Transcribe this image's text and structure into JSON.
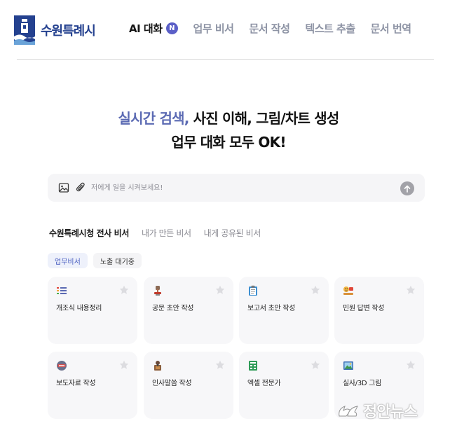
{
  "header": {
    "logo_text": "수원특례시",
    "nav": [
      {
        "label": "AI 대화",
        "badge": "N",
        "active": true
      },
      {
        "label": "업무 비서"
      },
      {
        "label": "문서 작성"
      },
      {
        "label": "텍스트 추출"
      },
      {
        "label": "문서 번역"
      }
    ]
  },
  "hero": {
    "accent": "실시간 검색,",
    "line1_rest": " 사진 이해, 그림/차트 생성",
    "line2": "업무 대화 모두 OK!"
  },
  "prompt": {
    "placeholder": "저에게 일을 시켜보세요!",
    "icons": [
      "image-icon",
      "paperclip-icon",
      "arrow-up-icon"
    ]
  },
  "tabs": [
    {
      "label": "수원특례시청 전사 비서",
      "active": true
    },
    {
      "label": "내가 만든 비서"
    },
    {
      "label": "내게 공유된 비서"
    }
  ],
  "chips": [
    {
      "label": "업무비서",
      "active": true
    },
    {
      "label": "노출 대기중"
    }
  ],
  "cards": [
    {
      "title": "개조식 내용정리",
      "icon": "list-icon"
    },
    {
      "title": "공문 초안 작성",
      "icon": "stamp-icon"
    },
    {
      "title": "보고서 초안 작성",
      "icon": "clipboard-icon"
    },
    {
      "title": "민원 답변 작성",
      "icon": "complaint-icon"
    },
    {
      "title": "보도자료 작성",
      "icon": "news-icon"
    },
    {
      "title": "인사말씀 작성",
      "icon": "speech-icon"
    },
    {
      "title": "엑셀 전문가",
      "icon": "spreadsheet-icon"
    },
    {
      "title": "실사/3D 그림",
      "icon": "picture-icon"
    }
  ],
  "watermark": {
    "text": "정안뉴스"
  },
  "colors": {
    "brand": "#24418f",
    "accent": "#5b6ab3",
    "badge": "#5b5fc7",
    "card_bg": "#f7f7f9",
    "chip_active_bg": "#eef1fb",
    "chip_active_text": "#4a5fc1"
  }
}
